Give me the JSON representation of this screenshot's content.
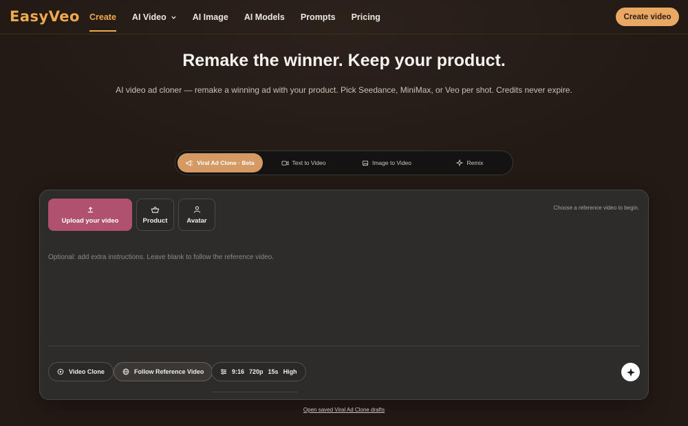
{
  "nav": {
    "logo": "EasyVeo",
    "links": [
      "Create",
      "AI Video",
      "AI Image",
      "AI Models",
      "Prompts",
      "Pricing"
    ],
    "cta": "Create video",
    "accent": "#f0a94e"
  },
  "hero": {
    "title": "Remake the winner. Keep your product.",
    "subtitle": "AI video ad cloner — remake a winning ad with your product. Pick Seedance, MiniMax, or Veo per shot. Credits never expire."
  },
  "tabs": [
    "Viral Ad Clone · Beta",
    "Text to Video",
    "Image to Video",
    "Remix"
  ],
  "panel": {
    "upload_label": "Upload your video",
    "product_label": "Product",
    "avatar_label": "Avatar",
    "hint": "Choose a reference video to begin.",
    "instructions_placeholder": "Optional: add extra instructions. Leave blank to follow the reference video.",
    "mode_pill": "Video Clone",
    "reference_pill": "Follow Reference Video",
    "settings": {
      "aspect": "9:16",
      "resolution": "720p",
      "duration": "15s",
      "quality": "High"
    }
  },
  "footer": {
    "drafts_link": "Open saved Viral Ad Clone drafts"
  }
}
